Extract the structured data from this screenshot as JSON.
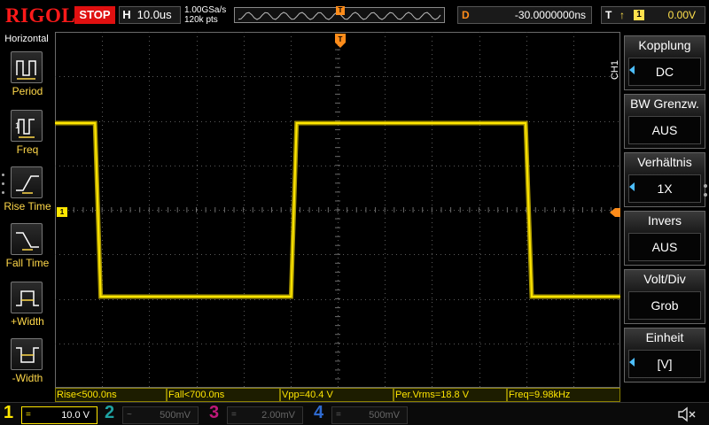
{
  "top": {
    "brand": "RIGOL",
    "run_state": "STOP",
    "timebase_label": "H",
    "timebase_value": "10.0us",
    "sample_rate": "1.00GSa/s",
    "memory_depth": "120k pts",
    "memory_marker": "T",
    "delay_label": "D",
    "delay_value": "-30.0000000ns",
    "trigger_label": "T",
    "trigger_edge": "↑",
    "trigger_source": "1",
    "trigger_level": "0.00V"
  },
  "left_menu": {
    "title": "Horizontal",
    "items": [
      {
        "label": "Period",
        "icon": "period-icon"
      },
      {
        "label": "Freq",
        "icon": "freq-icon"
      },
      {
        "label": "Rise Time",
        "icon": "rise-time-icon"
      },
      {
        "label": "Fall Time",
        "icon": "fall-time-icon"
      },
      {
        "label": "+Width",
        "icon": "pos-width-icon"
      },
      {
        "label": "-Width",
        "icon": "neg-width-icon"
      }
    ]
  },
  "screen": {
    "ch1_marker": "1",
    "trigger_top_marker": "T"
  },
  "measurements": [
    "Rise<500.0ns",
    "Fall<700.0ns",
    "Vpp=40.4 V",
    "Per.Vrms=18.8 V",
    "Freq=9.98kHz"
  ],
  "right_menu": {
    "channel_tag": "CH1",
    "items": [
      {
        "title": "Kopplung",
        "value": "DC",
        "arrow": true
      },
      {
        "title": "BW Grenzw.",
        "value": "AUS",
        "arrow": false
      },
      {
        "title": "Verhältnis",
        "value": "1X",
        "arrow": true
      },
      {
        "title": "Invers",
        "value": "AUS",
        "arrow": false
      },
      {
        "title": "Volt/Div",
        "value": "Grob",
        "arrow": false
      },
      {
        "title": "Einheit",
        "value": "[V]",
        "arrow": true
      }
    ]
  },
  "channels": [
    {
      "num": "1",
      "coupling": "=",
      "scale": "10.0 V",
      "color": "#ffe600",
      "active": true
    },
    {
      "num": "2",
      "coupling": "~",
      "scale": "500mV",
      "color": "#1fa3a3",
      "active": false
    },
    {
      "num": "3",
      "coupling": "=",
      "scale": "2.00mV",
      "color": "#c0187a",
      "active": false
    },
    {
      "num": "4",
      "coupling": "=",
      "scale": "500mV",
      "color": "#2f6ad0",
      "active": false
    }
  ],
  "colors": {
    "ch1": "#ffe600",
    "trigger": "#ff8c1a",
    "menu_arrow": "#4dbfff",
    "stop": "#e01010"
  },
  "chart_data": {
    "type": "line",
    "series_color": "#ffe600",
    "timebase_per_div": "10.0us",
    "volts_per_div": "10.0 V",
    "grid": true,
    "grid_divisions": {
      "x": 12,
      "y": 8
    },
    "waveform": "square",
    "x": [
      -60,
      -51.5,
      -50.3,
      -9.9,
      -8.7,
      39.9,
      41.2,
      60
    ],
    "y": [
      19.5,
      19.5,
      -19.5,
      -19.5,
      19.5,
      19.5,
      -19.5,
      -19.5
    ],
    "x_unit": "us",
    "y_unit": "V",
    "xlim": [
      -60,
      60
    ],
    "ylim": [
      -40,
      40
    ]
  }
}
